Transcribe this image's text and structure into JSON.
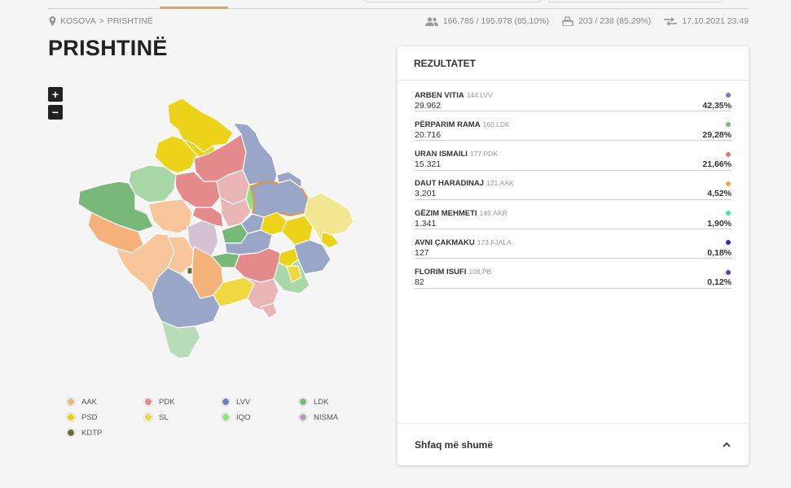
{
  "breadcrumb": {
    "root": "KOSOVA",
    "separator": ">",
    "current": "PRISHTINË"
  },
  "stats": {
    "voters": "166.785 / 195.978 (85,10%)",
    "stations": "203 / 238 (85,29%)",
    "updated": "17.10.2021 23:49"
  },
  "title": "PRISHTINË",
  "zoom": {
    "in": "+",
    "out": "−"
  },
  "legend": [
    {
      "label": "AAK",
      "color": "#f5b17a"
    },
    {
      "label": "PDK",
      "color": "#e48a8a"
    },
    {
      "label": "LVV",
      "color": "#6a7fb5"
    },
    {
      "label": "LDK",
      "color": "#78b878"
    },
    {
      "label": "PSD",
      "color": "#e8cf10"
    },
    {
      "label": "SL",
      "color": "#f0d840"
    },
    {
      "label": "IQO",
      "color": "#8fe07a"
    },
    {
      "label": "NISMA",
      "color": "#b89ab8"
    },
    {
      "label": "KDTP",
      "color": "#6b6b3a"
    }
  ],
  "panel": {
    "title": "REZULTATET",
    "results": [
      {
        "name": "ARBEN VITIA",
        "party": "144.LVV",
        "votes": "29.962",
        "pct": "42,35%",
        "color": "#6a7fb5"
      },
      {
        "name": "PËRPARIM RAMA",
        "party": "160.LDK",
        "votes": "20.716",
        "pct": "29,28%",
        "color": "#78b878"
      },
      {
        "name": "URAN ISMAILI",
        "party": "177.PDK",
        "votes": "15.321",
        "pct": "21,66%",
        "color": "#e07a6e"
      },
      {
        "name": "DAUT HARADINAJ",
        "party": "121.AAK",
        "votes": "3.201",
        "pct": "4,52%",
        "color": "#f5a64a"
      },
      {
        "name": "GËZIM MEHMETI",
        "party": "149.AKR",
        "votes": "1.341",
        "pct": "1,90%",
        "color": "#3de8a8"
      },
      {
        "name": "AVNI ÇAKMAKU",
        "party": "173.FJALA",
        "votes": "127",
        "pct": "0,18%",
        "color": "#2b2bd8"
      },
      {
        "name": "FLORIM ISUFI",
        "party": "108.PB",
        "votes": "82",
        "pct": "0,12%",
        "color": "#6a3ab0"
      }
    ],
    "more_label": "Shfaq më shumë"
  },
  "icons": {
    "pin": "map-pin-icon",
    "voters": "people-icon",
    "stations": "ballot-box-icon",
    "updated": "sync-arrows-icon",
    "chevron": "chevron-up-icon"
  }
}
